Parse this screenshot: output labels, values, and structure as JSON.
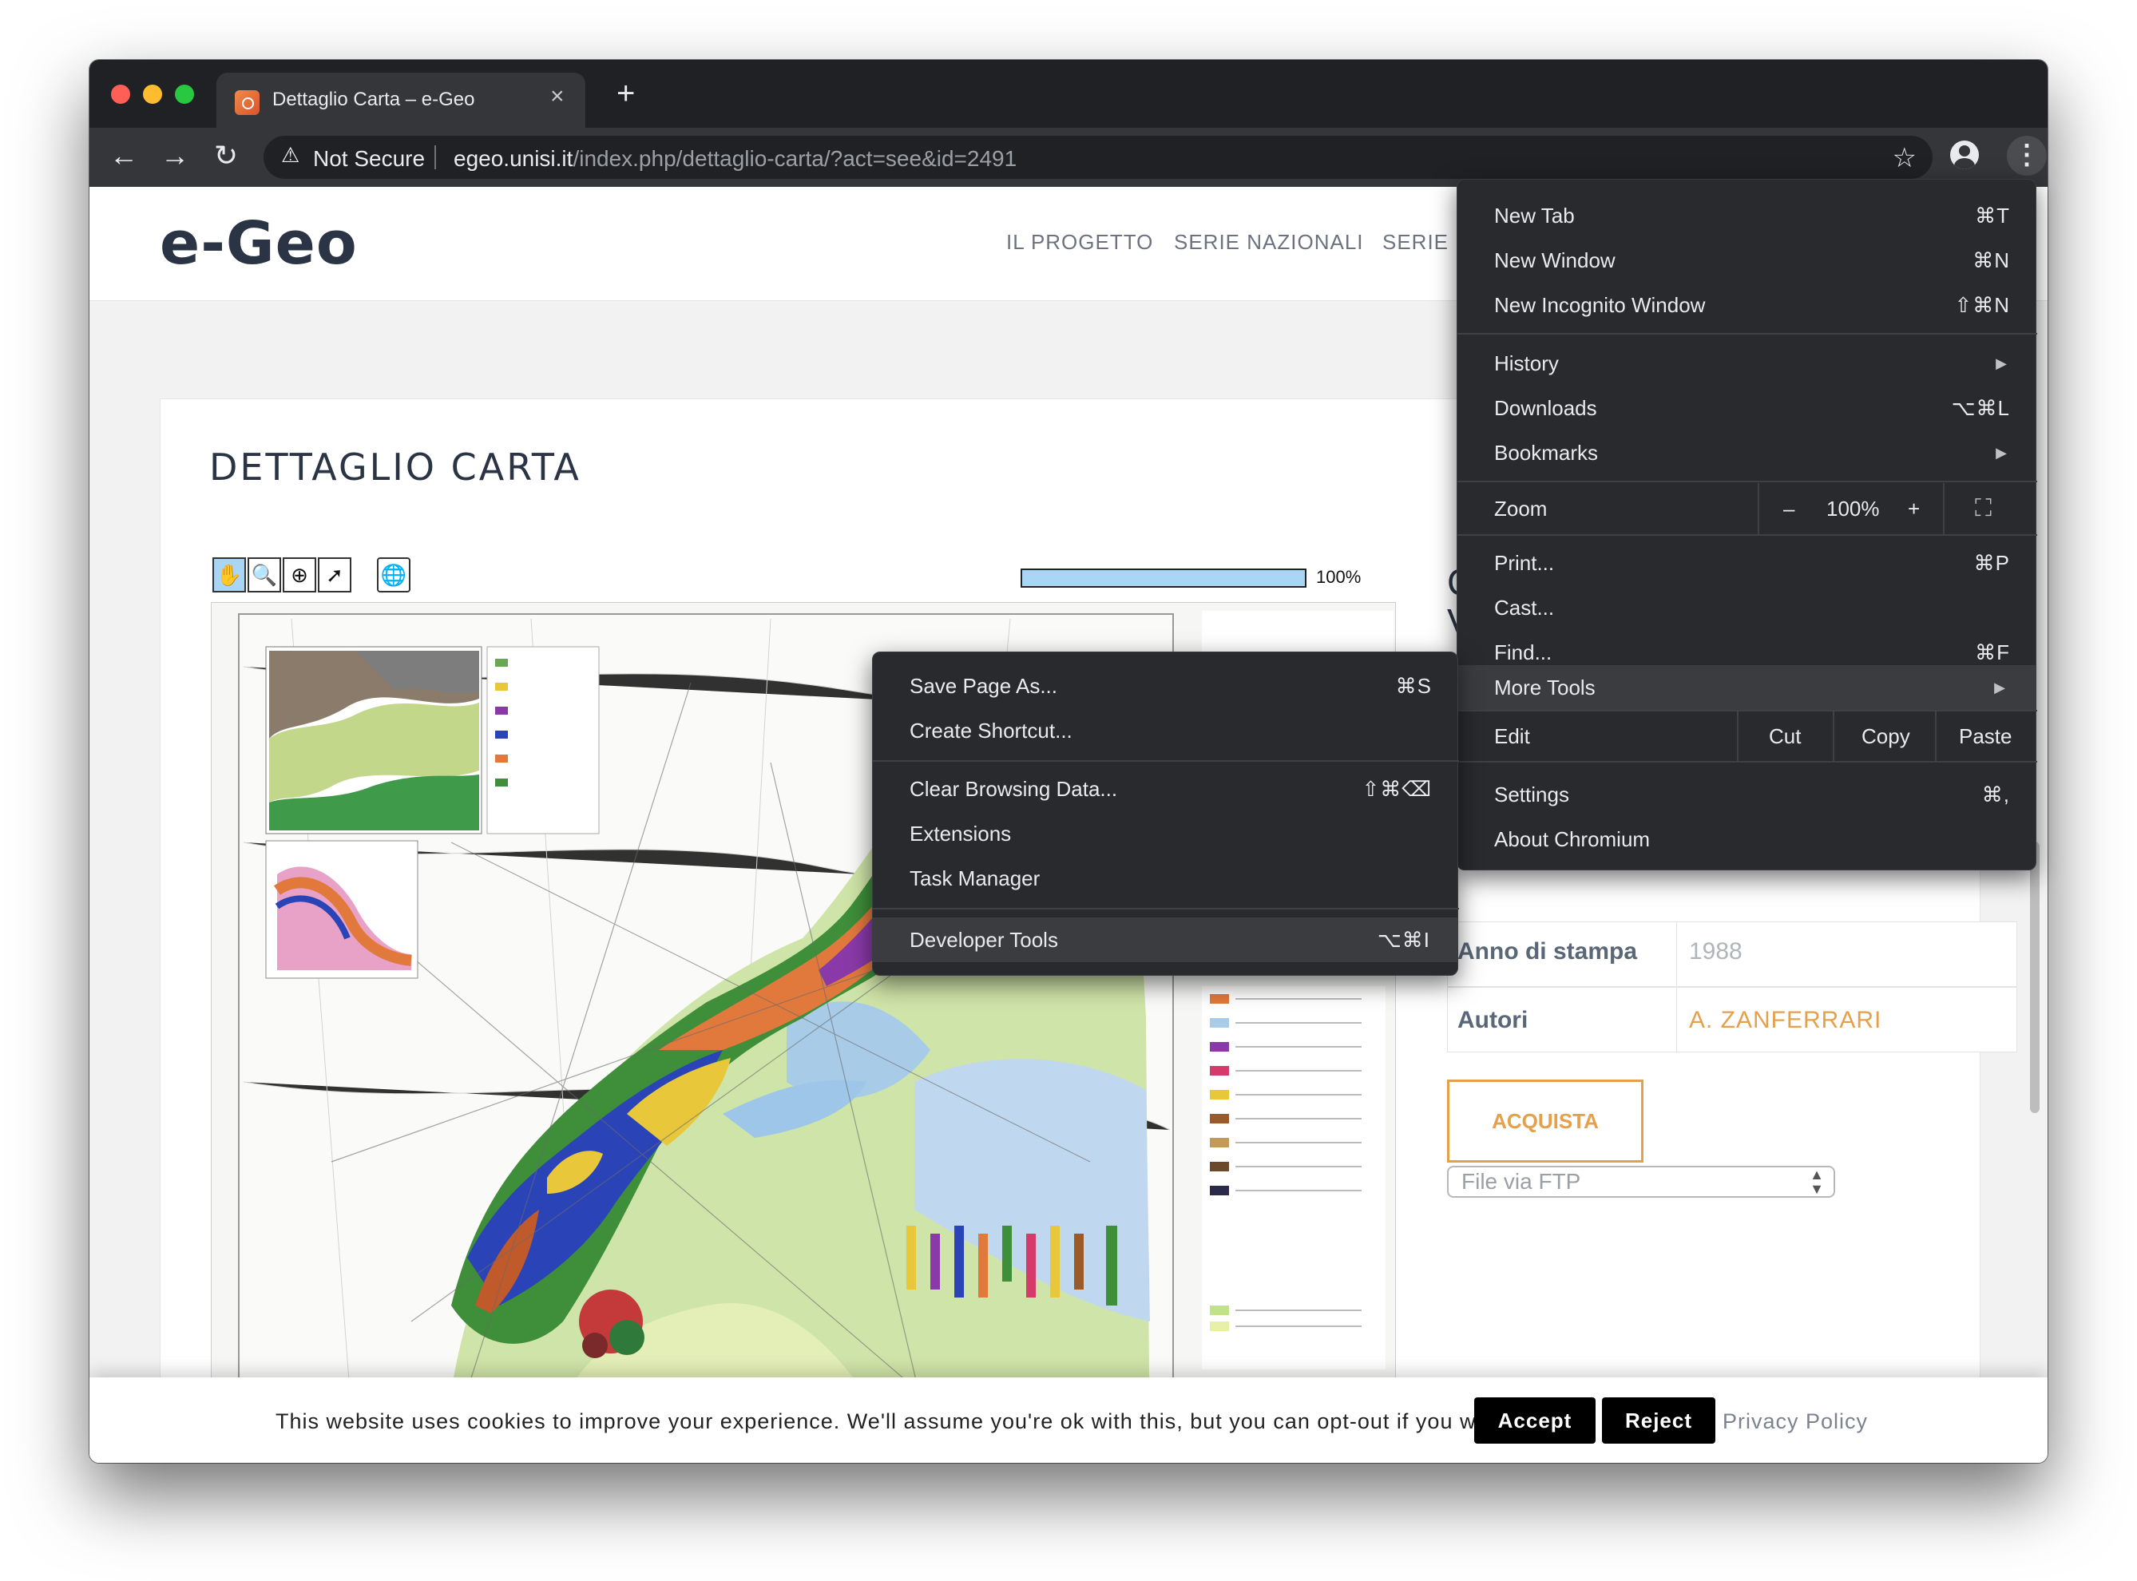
{
  "browser": {
    "tab_title": "Dettaglio Carta – e-Geo",
    "tab_close": "×",
    "new_tab": "+",
    "back": "←",
    "forward": "→",
    "reload": "↻",
    "security_icon": "⚠",
    "security_label": "Not Secure",
    "url_host": "egeo.unisi.it",
    "url_path": "/index.php/dettaglio-carta/?act=see&id=2491",
    "bookmark_star": "☆",
    "menu_kebab": "⋮"
  },
  "site": {
    "logo": "e-Geo",
    "nav": [
      "IL PROGETTO",
      "SERIE NAZIONALI",
      "SERIE I"
    ],
    "page_title": "DETTAGLIO CARTA",
    "viewer": {
      "tools": [
        "✋",
        "🔍",
        "⊕",
        "➚",
        "🌐"
      ],
      "zoom_percent": "100%",
      "zoom_level": 1.0
    },
    "partial_heading": "C\nV",
    "details": [
      {
        "label": "Anno di stampa",
        "value": "1988"
      },
      {
        "label": "Autori",
        "value": "A. ZANFERRARI"
      }
    ],
    "buy_button": "ACQUISTA",
    "format_select": "File via FTP"
  },
  "cookie_banner": {
    "text": "This website uses cookies to improve your experience. We'll assume you're ok with this, but you can opt-out if you wish.",
    "accept": "Accept",
    "reject": "Reject",
    "privacy": "Privacy Policy"
  },
  "chrome_menu": {
    "items": [
      {
        "label": "New Tab",
        "shortcut": "⌘T"
      },
      {
        "label": "New Window",
        "shortcut": "⌘N"
      },
      {
        "label": "New Incognito Window",
        "shortcut": "⇧⌘N"
      },
      {
        "label": "History",
        "shortcut": "▶"
      },
      {
        "label": "Downloads",
        "shortcut": "⌥⌘L"
      },
      {
        "label": "Bookmarks",
        "shortcut": "▶"
      },
      {
        "label": "Print...",
        "shortcut": "⌘P"
      },
      {
        "label": "Cast...",
        "shortcut": ""
      },
      {
        "label": "Find...",
        "shortcut": "⌘F"
      },
      {
        "label": "More Tools",
        "shortcut": "▶"
      },
      {
        "label": "Settings",
        "shortcut": "⌘,"
      },
      {
        "label": "About Chromium",
        "shortcut": ""
      }
    ],
    "zoom": {
      "label": "Zoom",
      "minus": "–",
      "value": "100%",
      "plus": "+",
      "fullscreen": "⛶"
    },
    "edit": {
      "label": "Edit",
      "cut": "Cut",
      "copy": "Copy",
      "paste": "Paste"
    }
  },
  "more_tools_menu": {
    "items": [
      {
        "label": "Save Page As...",
        "shortcut": "⌘S"
      },
      {
        "label": "Create Shortcut...",
        "shortcut": ""
      },
      {
        "label": "Clear Browsing Data...",
        "shortcut": "⇧⌘⌫"
      },
      {
        "label": "Extensions",
        "shortcut": ""
      },
      {
        "label": "Task Manager",
        "shortcut": ""
      },
      {
        "label": "Developer Tools",
        "shortcut": "⌥⌘I"
      }
    ]
  },
  "colors": {
    "titlebar": "#202124",
    "toolbar": "#35363a",
    "menu_bg": "#292a2d",
    "accent_orange": "#e5a04c",
    "traffic_red": "#ff5f57",
    "traffic_yellow": "#febc2e",
    "traffic_green": "#28c840"
  }
}
